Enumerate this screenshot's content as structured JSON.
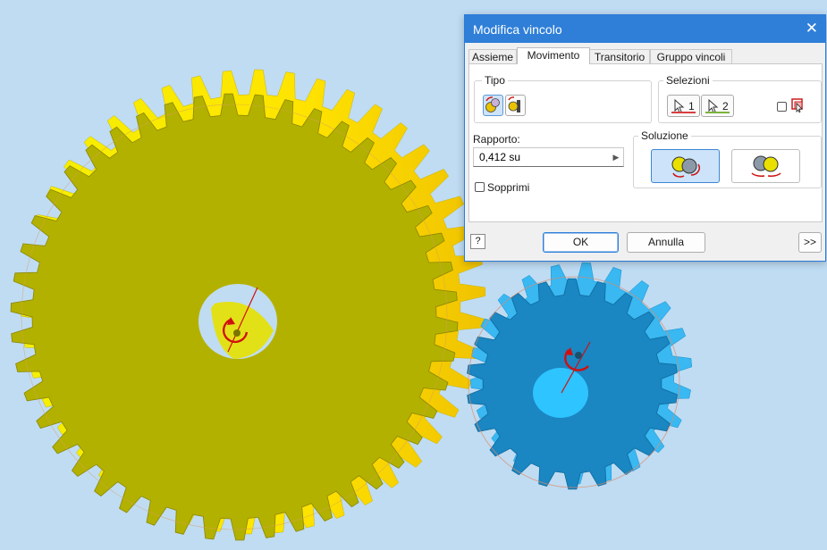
{
  "dialog": {
    "title": "Modifica vincolo",
    "close_glyph": "✕",
    "tabs": [
      {
        "label": "Assieme"
      },
      {
        "label": "Movimento"
      },
      {
        "label": "Transitorio"
      },
      {
        "label": "Gruppo vincoli"
      }
    ],
    "active_tab": "Movimento",
    "tipo": {
      "label": "Tipo",
      "buttons": [
        {
          "icon": "rotation-rotation-icon",
          "selected": true
        },
        {
          "icon": "rotation-translation-icon",
          "selected": false
        }
      ]
    },
    "selezioni": {
      "label": "Selezioni",
      "pick1_label": "1",
      "pick2_label": "2",
      "pick1_color": "#d94040",
      "pick2_color": "#7bb33a",
      "icons": [
        "cursor-arrow-icon",
        "select-other-icon"
      ]
    },
    "rapporto": {
      "label": "Rapporto:",
      "value": "0,412 su",
      "arrow_glyph": "▶"
    },
    "sopprimi": {
      "label": "Sopprimi",
      "checked": false
    },
    "soluzione": {
      "label": "Soluzione",
      "options": [
        {
          "icon": "forward-rotation-icon",
          "selected": true
        },
        {
          "icon": "reverse-rotation-icon",
          "selected": false
        }
      ]
    },
    "buttons": {
      "help_glyph": "?",
      "ok": "OK",
      "cancel": "Annulla",
      "more": ">>"
    }
  },
  "viewport": {
    "background": "#bfdcf3",
    "large_gear_color": "#e6e600",
    "small_gear_color": "#1aa3e8"
  }
}
